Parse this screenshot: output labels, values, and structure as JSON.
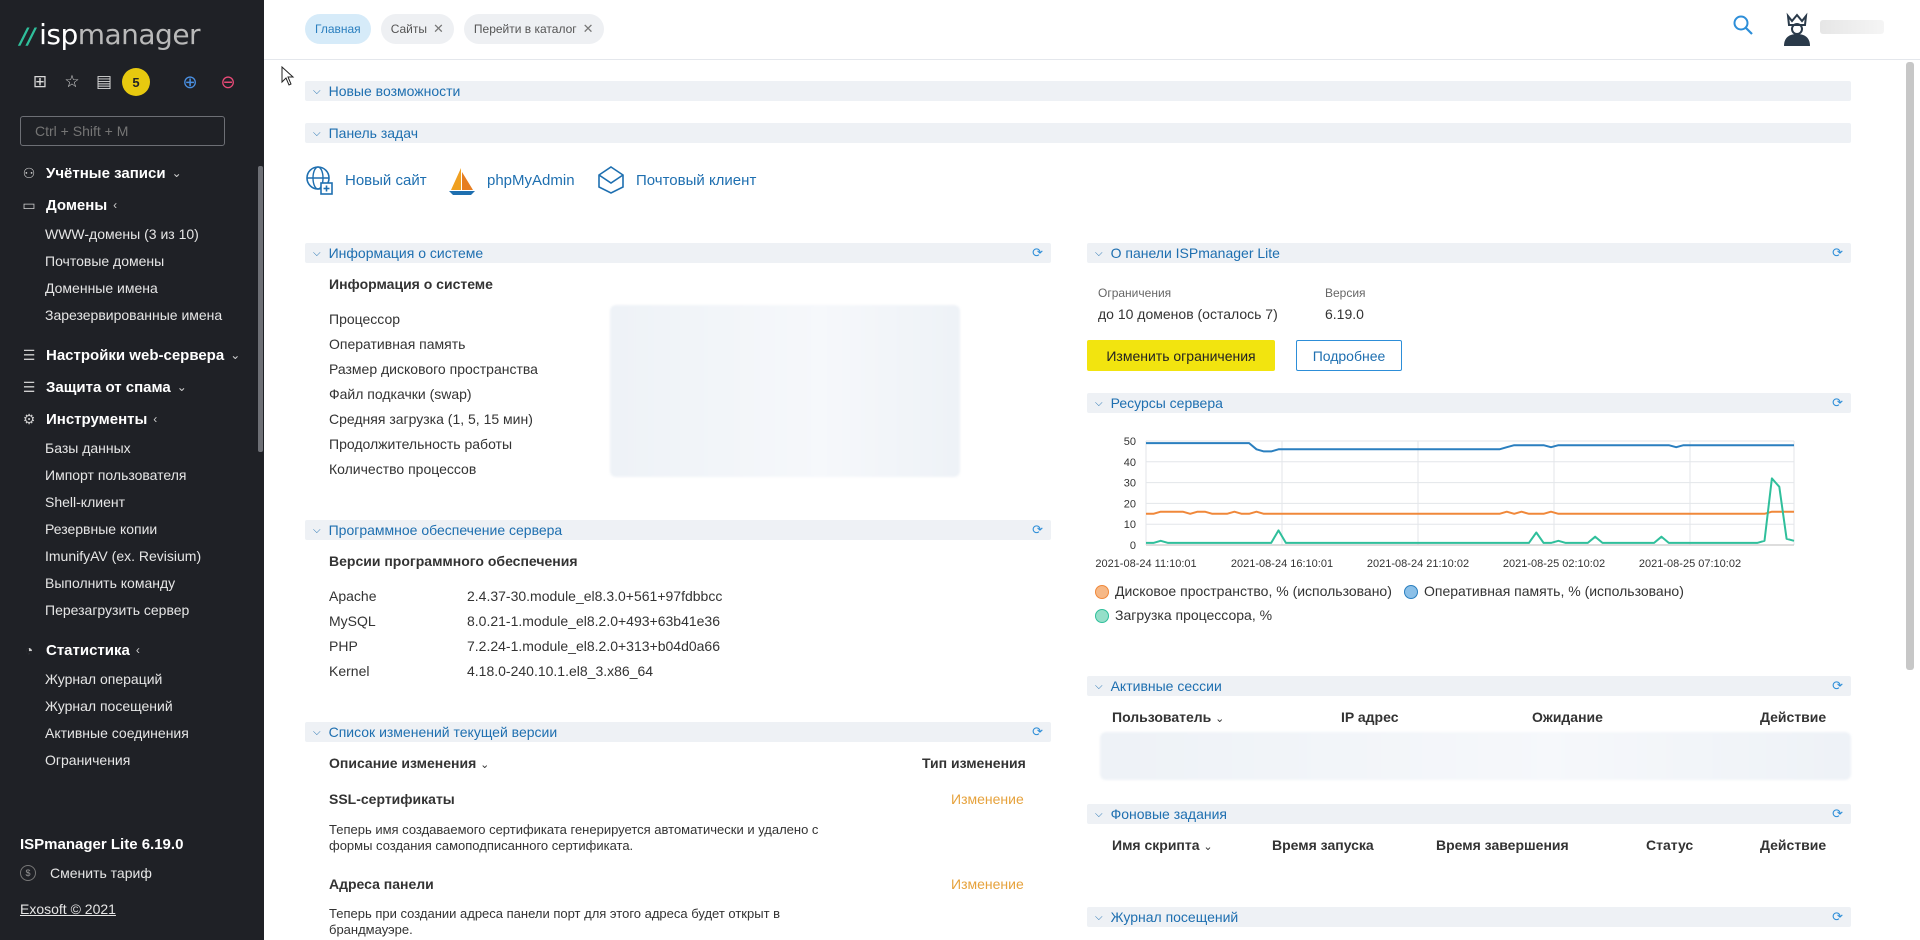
{
  "sidebar": {
    "logo_prefix": "isp",
    "logo_suffix": "manager",
    "badge_count": "5",
    "search_placeholder": "Ctrl + Shift + M",
    "groups": [
      {
        "label": "Учётные записи",
        "chev": "⌄",
        "items": []
      },
      {
        "label": "Домены",
        "chev": "‹",
        "items": [
          "WWW-домены (3 из 10)",
          "Почтовые домены",
          "Доменные имена",
          "Зарезервированные имена"
        ]
      },
      {
        "label": "Настройки web-сервера",
        "chev": "⌄",
        "items": []
      },
      {
        "label": "Защита от спама",
        "chev": "⌄",
        "items": []
      },
      {
        "label": "Инструменты",
        "chev": "‹",
        "items": [
          "Базы данных",
          "Импорт пользователя",
          "Shell-клиент",
          "Резервные копии",
          "ImunifyAV (ex. Revisium)",
          "Выполнить команду",
          "Перезагрузить сервер"
        ]
      },
      {
        "label": "Статистика",
        "chev": "‹",
        "items": [
          "Журнал операций",
          "Журнал посещений",
          "Активные соединения",
          "Ограничения"
        ]
      }
    ],
    "footer": {
      "version": "ISPmanager Lite 6.19.0",
      "tariff": "Сменить тариф",
      "copyright": "Exosoft © 2021"
    }
  },
  "topbar": {
    "tabs": [
      {
        "label": "Главная",
        "active": true
      },
      {
        "label": "Сайты",
        "active": false
      },
      {
        "label": "Перейти в каталог",
        "active": false
      }
    ]
  },
  "sections": {
    "new_features": "Новые возможности",
    "task_panel": "Панель задач",
    "system_info": "Информация о системе",
    "software": "Программное обеспечение сервера",
    "changelog": "Список изменений текущей версии",
    "about": "О панели ISPmanager Lite",
    "resources": "Ресурсы сервера",
    "sessions": "Активные сессии",
    "background_jobs": "Фоновые задания",
    "visit_log": "Журнал посещений"
  },
  "quick_actions": [
    "Новый сайт",
    "phpMyAdmin",
    "Почтовый клиент"
  ],
  "system_info": {
    "title": "Информация о системе",
    "rows": [
      "Процессор",
      "Оперативная память",
      "Размер дискового пространства",
      "Файл подкачки (swap)",
      "Средняя загрузка (1, 5, 15 мин)",
      "Продолжительность работы",
      "Количество процессов"
    ]
  },
  "software": {
    "title": "Версии программного обеспечения",
    "rows": [
      {
        "name": "Apache",
        "version": "2.4.37-30.module_el8.3.0+561+97fdbbcc"
      },
      {
        "name": "MySQL",
        "version": "8.0.21-1.module_el8.2.0+493+63b41e36"
      },
      {
        "name": "PHP",
        "version": "7.2.24-1.module_el8.2.0+313+b04d0a66"
      },
      {
        "name": "Kernel",
        "version": "4.18.0-240.10.1.el8_3.x86_64"
      }
    ]
  },
  "changelog": {
    "col_desc": "Описание изменения",
    "col_type": "Тип изменения",
    "items": [
      {
        "title": "SSL-сертификаты",
        "type": "Изменение",
        "text1": "Теперь имя создаваемого сертификата генерируется автоматически и удалено с",
        "text2": "формы создания самоподписанного сертификата."
      },
      {
        "title": "Адреса панели",
        "type": "Изменение",
        "text1": "Теперь при создании адреса панели порт для этого адреса будет открыт в",
        "text2": "брандмауэре."
      }
    ]
  },
  "about": {
    "limits_label": "Ограничения",
    "limits_value": "до 10 доменов (осталось 7)",
    "version_label": "Версия",
    "version_value": "6.19.0",
    "change_button": "Изменить ограничения",
    "more_button": "Подробнее"
  },
  "sessions": {
    "cols": [
      "Пользователь",
      "IP адрес",
      "Ожидание",
      "Действие"
    ]
  },
  "background_jobs": {
    "cols": [
      "Имя скрипта",
      "Время запуска",
      "Время завершения",
      "Статус",
      "Действие"
    ]
  },
  "colors": {
    "accent": "#1e6fb0",
    "disk": "#f0883a",
    "ram": "#2a7fbf",
    "cpu": "#2fbf9b",
    "yellow": "#f2e40f"
  },
  "chart_data": {
    "type": "line",
    "x": [
      "2021-08-24 11:10:01",
      "2021-08-24 16:10:01",
      "2021-08-24 21:10:02",
      "2021-08-25 02:10:02",
      "2021-08-25 07:10:02"
    ],
    "ylim": [
      0,
      50
    ],
    "yticks": [
      0,
      10,
      20,
      30,
      40,
      50
    ],
    "series": [
      {
        "name": "Оперативная память, % (использовано)",
        "color": "#2a7fbf",
        "values": [
          49,
          49,
          49,
          49,
          49,
          49,
          49,
          49,
          49,
          49,
          49,
          49,
          49,
          49,
          49,
          46,
          45,
          45,
          46,
          46,
          46,
          46,
          46,
          46,
          46,
          46,
          46,
          46,
          46,
          46,
          46,
          46,
          46,
          46,
          46,
          46,
          46,
          46,
          46,
          46,
          46,
          46,
          46,
          46,
          46,
          46,
          46,
          46,
          46,
          47,
          48,
          48,
          48,
          48,
          48,
          47,
          48,
          48,
          48,
          48,
          48,
          48,
          48,
          48,
          48,
          48,
          48,
          48,
          48,
          48,
          48,
          48,
          47,
          48,
          48,
          48,
          48,
          48,
          48,
          48,
          48,
          48,
          48,
          48,
          48,
          48,
          48,
          48,
          48
        ]
      },
      {
        "name": "Дисковое пространство, % (использовано)",
        "color": "#f0883a",
        "values": [
          15,
          15,
          16,
          16,
          16,
          16,
          15,
          16,
          16,
          15,
          15,
          15,
          16,
          15,
          15,
          16,
          15,
          15,
          15,
          15,
          15,
          15,
          15,
          15,
          15,
          15,
          15,
          15,
          15,
          15,
          15,
          15,
          15,
          15,
          15,
          15,
          15,
          15,
          15,
          15,
          15,
          15,
          15,
          15,
          15,
          15,
          15,
          15,
          15,
          16,
          15,
          16,
          15,
          15,
          15,
          16,
          15,
          15,
          15,
          15,
          15,
          15,
          15,
          15,
          15,
          15,
          15,
          15,
          15,
          15,
          15,
          15,
          15,
          15,
          15,
          15,
          15,
          15,
          15,
          15,
          15,
          15,
          15,
          15,
          15,
          16,
          16,
          16,
          16
        ]
      },
      {
        "name": "Загрузка процессора, %",
        "color": "#2fbf9b",
        "values": [
          1,
          1,
          2,
          1,
          1,
          1,
          1,
          1,
          1,
          1,
          1,
          1,
          1,
          1,
          1,
          1,
          1,
          1,
          7,
          1,
          1,
          1,
          1,
          1,
          1,
          1,
          1,
          1,
          1,
          1,
          1,
          1,
          1,
          1,
          1,
          1,
          1,
          1,
          1,
          1,
          1,
          1,
          1,
          1,
          1,
          1,
          1,
          1,
          1,
          1,
          1,
          1,
          1,
          6,
          1,
          1,
          2,
          1,
          1,
          1,
          1,
          4,
          1,
          1,
          1,
          1,
          1,
          1,
          1,
          1,
          4,
          1,
          1,
          1,
          1,
          1,
          1,
          1,
          1,
          1,
          1,
          1,
          1,
          1,
          2,
          32,
          28,
          3,
          2
        ]
      }
    ]
  }
}
